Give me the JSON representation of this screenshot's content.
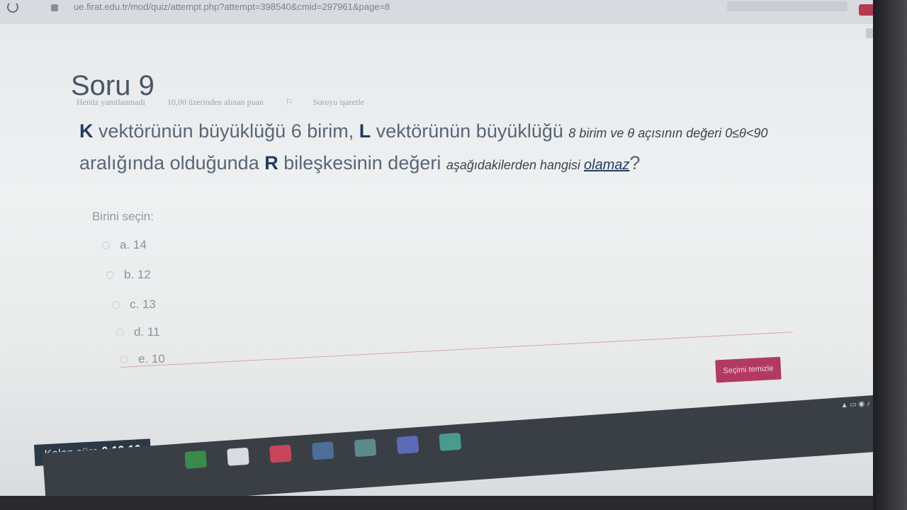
{
  "browser": {
    "url": "ue.firat.edu.tr/mod/quiz/attempt.php?attempt=398540&cmid=297961&page=8"
  },
  "question": {
    "title": "Soru 9",
    "status": "Henüz yanıtlanmadı",
    "points": "10,00 üzerinden alınan puan",
    "flag_label": "Soruyu işaretle",
    "text": {
      "k": "K",
      "part1": " vektörünün büyüklüğü 6 birim, ",
      "l": "L",
      "part2": " vektörünün büyüklüğü ",
      "part3": "8 birim ve θ açısının değeri 0≤θ<90",
      "part4": " aralığında olduğunda ",
      "r": "R",
      "part5": " bileşkesinin değeri ",
      "part6": "aşağıdakilerden hangisi ",
      "olamaz": "olamaz",
      "qmark": "?"
    },
    "prompt": "Birini seçin:",
    "options": [
      {
        "label": "a. 14"
      },
      {
        "label": "b. 12"
      },
      {
        "label": "c. 13"
      },
      {
        "label": "d. 11"
      },
      {
        "label": "e. 10"
      }
    ],
    "clear_button": "Seçimi temizle"
  },
  "timer": {
    "label": "Kalan süre",
    "value": "0:10:16"
  },
  "colors": {
    "accent": "#b23a62",
    "timer_bg": "#2c3846"
  }
}
